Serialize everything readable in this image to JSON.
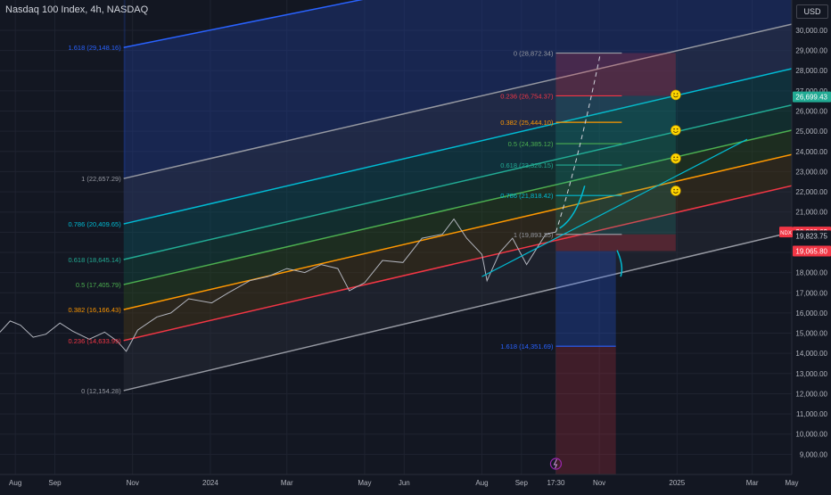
{
  "header": {
    "title": "Nasdaq 100 Index, 4h, NASDAQ",
    "currency": "USD"
  },
  "colors": {
    "bg": "#131722",
    "grid": "#1f2330",
    "price": "#b2b5be",
    "channel": "#9598a1",
    "red": "#f23645",
    "orange": "#ff9800",
    "green": "#4caf50",
    "teal": "#22ab94",
    "cyan": "#00bcd4",
    "blue": "#2962ff"
  },
  "chart_data": {
    "type": "line",
    "symbol": "NDX",
    "x_range": [
      "2023-07-20",
      "2025-04-01"
    ],
    "y_range": [
      8000,
      31500
    ],
    "y_ticks": [
      "9,000.00",
      "10,000.00",
      "11,000.00",
      "12,000.00",
      "13,000.00",
      "14,000.00",
      "15,000.00",
      "16,000.00",
      "17,000.00",
      "18,000.00",
      "19,000.00",
      "20,000.00",
      "21,000.00",
      "22,000.00",
      "23,000.00",
      "24,000.00",
      "25,000.00",
      "26,000.00",
      "27,000.00",
      "28,000.00",
      "29,000.00",
      "30,000.00"
    ],
    "x_ticks": [
      {
        "label": "Aug",
        "date": "2023-08-01"
      },
      {
        "label": "Sep",
        "date": "2023-09-01"
      },
      {
        "label": "Nov",
        "date": "2023-11-01"
      },
      {
        "label": "2024",
        "date": "2024-01-01"
      },
      {
        "label": "Mar",
        "date": "2024-03-01"
      },
      {
        "label": "May",
        "date": "2024-05-01"
      },
      {
        "label": "Jun",
        "date": "2024-06-01"
      },
      {
        "label": "Aug",
        "date": "2024-08-01"
      },
      {
        "label": "Sep",
        "date": "2024-09-01"
      },
      {
        "label": "17:30",
        "date": "2024-09-28"
      },
      {
        "label": "Nov",
        "date": "2024-11-01"
      },
      {
        "label": "2025",
        "date": "2025-01-01"
      },
      {
        "label": "Mar",
        "date": "2025-03-01"
      },
      {
        "label": "May",
        "date": "2025-04-01"
      }
    ],
    "price": [
      {
        "date": "2023-07-20",
        "value": 15050
      },
      {
        "date": "2023-07-28",
        "value": 15600
      },
      {
        "date": "2023-08-05",
        "value": 15400
      },
      {
        "date": "2023-08-15",
        "value": 14800
      },
      {
        "date": "2023-08-25",
        "value": 14950
      },
      {
        "date": "2023-09-05",
        "value": 15500
      },
      {
        "date": "2023-09-15",
        "value": 15100
      },
      {
        "date": "2023-09-28",
        "value": 14700
      },
      {
        "date": "2023-10-10",
        "value": 15050
      },
      {
        "date": "2023-10-20",
        "value": 14600
      },
      {
        "date": "2023-10-27",
        "value": 14100
      },
      {
        "date": "2023-11-05",
        "value": 15150
      },
      {
        "date": "2023-11-20",
        "value": 15800
      },
      {
        "date": "2023-12-01",
        "value": 16000
      },
      {
        "date": "2023-12-15",
        "value": 16700
      },
      {
        "date": "2024-01-02",
        "value": 16500
      },
      {
        "date": "2024-01-15",
        "value": 17000
      },
      {
        "date": "2024-02-01",
        "value": 17600
      },
      {
        "date": "2024-02-15",
        "value": 17800
      },
      {
        "date": "2024-03-01",
        "value": 18200
      },
      {
        "date": "2024-03-15",
        "value": 18000
      },
      {
        "date": "2024-03-28",
        "value": 18400
      },
      {
        "date": "2024-04-10",
        "value": 18200
      },
      {
        "date": "2024-04-19",
        "value": 17100
      },
      {
        "date": "2024-05-01",
        "value": 17500
      },
      {
        "date": "2024-05-15",
        "value": 18600
      },
      {
        "date": "2024-05-31",
        "value": 18500
      },
      {
        "date": "2024-06-15",
        "value": 19700
      },
      {
        "date": "2024-07-01",
        "value": 19900
      },
      {
        "date": "2024-07-10",
        "value": 20650
      },
      {
        "date": "2024-07-20",
        "value": 19700
      },
      {
        "date": "2024-08-01",
        "value": 18900
      },
      {
        "date": "2024-08-05",
        "value": 17600
      },
      {
        "date": "2024-08-15",
        "value": 19000
      },
      {
        "date": "2024-08-25",
        "value": 19700
      },
      {
        "date": "2024-09-05",
        "value": 18400
      },
      {
        "date": "2024-09-12",
        "value": 19100
      },
      {
        "date": "2024-09-20",
        "value": 19900
      },
      {
        "date": "2024-09-28",
        "value": 20008.62
      }
    ],
    "channel": {
      "upper": [
        {
          "date": "2023-10-25",
          "value": 22657.29
        },
        {
          "date": "2025-04-01",
          "value": 30300
        }
      ],
      "lower": [
        {
          "date": "2023-10-25",
          "value": 12154.28
        },
        {
          "date": "2025-04-01",
          "value": 20000
        }
      ]
    },
    "fib_lines": [
      {
        "label": "1.618 (29,148.16)",
        "level": "1.618",
        "start": 29148.16,
        "end": 35800,
        "color": "#2962ff",
        "fill": "#1e3a8a"
      },
      {
        "label": "0.786 (20,409.65)",
        "level": "0.786",
        "start": 20409.65,
        "end": 28100,
        "color": "#00bcd4",
        "fill": "#0e4f5c"
      },
      {
        "label": "0.618 (18,645.14)",
        "level": "0.618",
        "start": 18645.14,
        "end": 26300,
        "color": "#22ab94",
        "fill": "#124a3e"
      },
      {
        "label": "0.5 (17,405.79)",
        "level": "0.5",
        "start": 17405.79,
        "end": 25050,
        "color": "#4caf50",
        "fill": "#2a4a20"
      },
      {
        "label": "0.382 (16,166.43)",
        "level": "0.382",
        "start": 16166.43,
        "end": 23850,
        "color": "#ff9800",
        "fill": "#4a3a18"
      },
      {
        "label": "0.236 (14,633.99)",
        "level": "0.236",
        "start": 14633.99,
        "end": 22300,
        "color": "#f23645",
        "fill": "#4a1f26"
      }
    ],
    "fib_left_start": "2023-10-25",
    "projection": {
      "start": "2024-09-28",
      "end": "2024-12-31",
      "levels": [
        {
          "label": "0 (28,872.34)",
          "value": 28872.34,
          "color": "#9598a1"
        },
        {
          "label": "0.236 (26,754.37)",
          "value": 26754.37,
          "color": "#f23645"
        },
        {
          "label": "0.382 (25,444.10)",
          "value": 25444.1,
          "color": "#ff9800"
        },
        {
          "label": "0.5 (24,385.12)",
          "value": 24385.12,
          "color": "#4caf50"
        },
        {
          "label": "0.618 (23,326.15)",
          "value": 23326.15,
          "color": "#22ab94"
        },
        {
          "label": "0.786 (21,818.42)",
          "value": 21818.42,
          "color": "#00bcd4"
        },
        {
          "label": "1 (19,893.35)",
          "value": 19893.35,
          "color": "#9598a1"
        },
        {
          "label": "1.618 (14,351.69)",
          "value": 14351.69,
          "color": "#2962ff"
        }
      ]
    },
    "price_labels": [
      {
        "text": "26,699.43",
        "value": 26699.43,
        "bg": "#22ab94",
        "fg": "#ffffff"
      },
      {
        "text": "20,008.62",
        "value": 20008.62,
        "bg": "#f23645",
        "fg": "#ffffff",
        "tag": "NDX"
      },
      {
        "text": "19,823.75",
        "value": 19823.75,
        "bg": "#131722",
        "fg": "#d1d4dc"
      },
      {
        "text": "19,065.80",
        "value": 19065.8,
        "bg": "#f23645",
        "fg": "#ffffff"
      }
    ],
    "smileys": [
      {
        "date": "2024-12-31",
        "value": 26800
      },
      {
        "date": "2024-12-31",
        "value": 25050
      },
      {
        "date": "2024-12-31",
        "value": 23650
      },
      {
        "date": "2024-12-31",
        "value": 22050
      }
    ]
  }
}
